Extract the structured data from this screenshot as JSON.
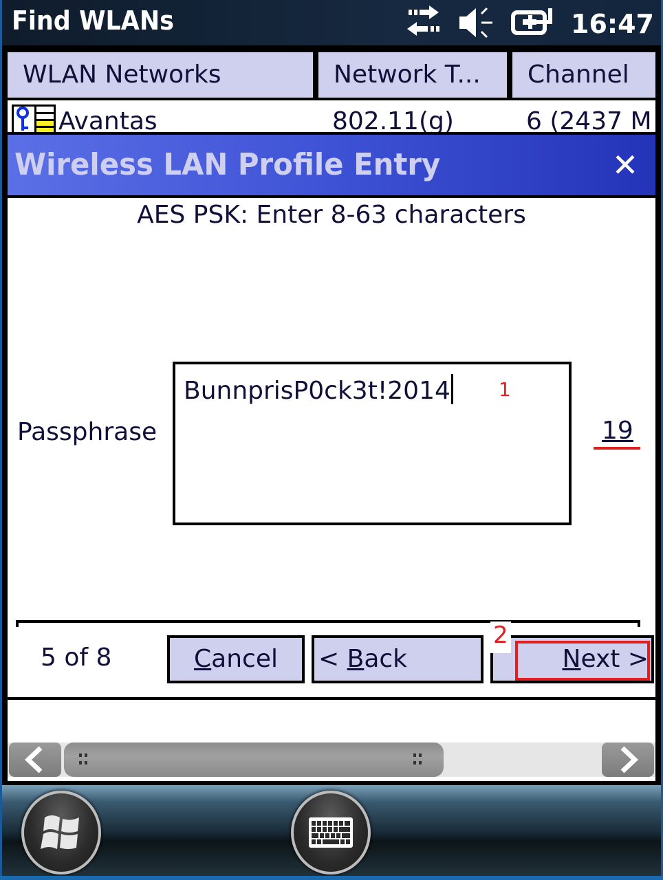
{
  "status_bar": {
    "title": "Find WLANs",
    "icons": [
      "data-transfer-icon",
      "speaker-muted-icon",
      "battery-charging-icon"
    ],
    "time": "16:47"
  },
  "list": {
    "columns": [
      "WLAN Networks",
      "Network T...",
      "Channel"
    ],
    "rows": [
      {
        "icon": "key-signal-icon",
        "name": "Avantas",
        "type": "802.11(g)",
        "channel": "6 (2437 M"
      }
    ]
  },
  "dialog": {
    "title": "Wireless LAN Profile Entry",
    "close_label": "✕",
    "instruction": "AES PSK: Enter 8-63 characters",
    "passphrase_label": "Passphrase",
    "passphrase_value": "BunnprisP0ck3t!2014",
    "char_count": "19",
    "step": "5 of 8",
    "buttons": {
      "cancel_pre": "",
      "cancel_key": "C",
      "cancel_rest": "ancel",
      "back_pre": "< ",
      "back_key": "B",
      "back_rest": "ack",
      "next_pre": "",
      "next_key": "N",
      "next_rest": "ext >"
    },
    "annotations": {
      "first": "1",
      "second": "2"
    },
    "accent_colors": {
      "title_bar": "#3e52d6",
      "button_bg": "#cfcfee",
      "annotation": "#e02020"
    }
  },
  "scrollbar": {
    "position_fraction": 0.0,
    "visible_fraction": 0.6
  },
  "taskbar": {
    "buttons": [
      "start-button",
      "keyboard-button"
    ]
  }
}
